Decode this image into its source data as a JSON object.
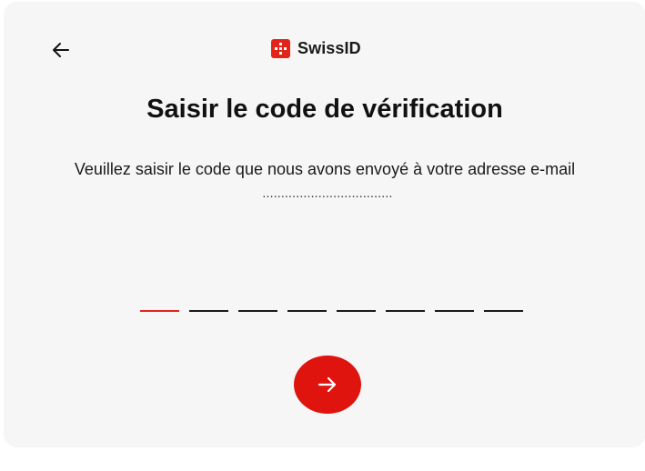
{
  "header": {
    "back_icon": "arrow-left-icon",
    "logo_icon": "swissid-logo-icon",
    "brand_name": "SwissID"
  },
  "main": {
    "title": "Saisir le code de vérification",
    "instruction_text": "Veuillez saisir le code que nous avons envoyé à votre adresse e-mail",
    "masked_email": "...................................",
    "code_slots": [
      "",
      "",
      "",
      "",
      "",
      "",
      "",
      ""
    ],
    "active_slot_index": 0,
    "submit_icon": "arrow-right-icon"
  },
  "colors": {
    "accent": "#e1251b",
    "background": "#f6f6f6",
    "text": "#111111"
  }
}
